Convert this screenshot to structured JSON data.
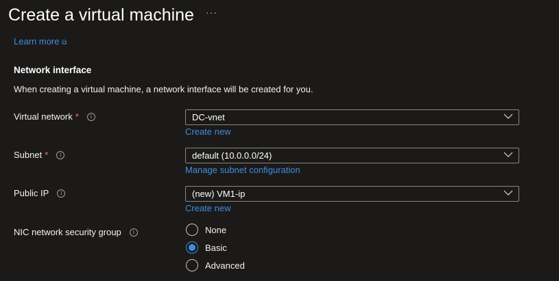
{
  "header": {
    "title": "Create a virtual machine",
    "more_label": "···"
  },
  "learn_more": "Learn more",
  "section": {
    "heading": "Network interface",
    "description": "When creating a virtual machine, a network interface will be created for you."
  },
  "fields": {
    "vnet": {
      "label": "Virtual network",
      "required": "*",
      "value": "DC-vnet",
      "link": "Create new"
    },
    "subnet": {
      "label": "Subnet",
      "required": "*",
      "value": "default (10.0.0.0/24)",
      "link": "Manage subnet configuration"
    },
    "public_ip": {
      "label": "Public IP",
      "value": "(new) VM1-ip",
      "link": "Create new"
    },
    "nsg": {
      "label": "NIC network security group",
      "options": [
        "None",
        "Basic",
        "Advanced"
      ],
      "selected": "Basic"
    }
  },
  "info_glyph": "i",
  "colors": {
    "accent": "#3e8ede",
    "required": "#f1707b",
    "background": "#1b1a19"
  }
}
